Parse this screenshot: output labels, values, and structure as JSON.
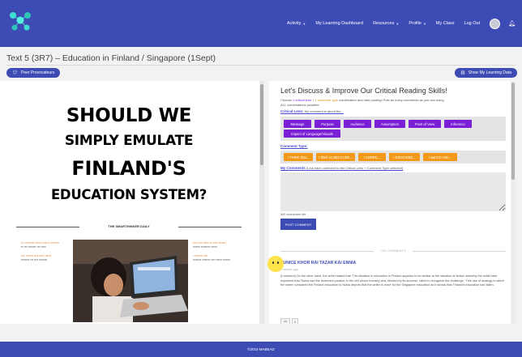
{
  "nav": {
    "items": [
      {
        "label": "Activity",
        "caret": true
      },
      {
        "label": "My Learning Dashboard",
        "caret": false
      },
      {
        "label": "Resources",
        "caret": true
      },
      {
        "label": "Profile",
        "caret": true
      },
      {
        "label": "My Class",
        "caret": false
      },
      {
        "label": "Log Out",
        "caret": false
      }
    ]
  },
  "page": {
    "title": "Text 5 (3R7) – Education in Finland / Singapore (1Sept)"
  },
  "buttons": {
    "peer": "Peer Provocateurs",
    "learning_data": "Show My Learning Data"
  },
  "article": {
    "headline_lines": [
      "SHOULD WE",
      "SIMPLY EMULATE",
      "FINLAND'S",
      "EDUCATION SYSTEM?"
    ],
    "byline": "THE SMARTHINKER DAILY"
  },
  "panel": {
    "title": "Let's Discuss & Improve Our Critical Reading Skills!",
    "instr_1": "Choose",
    "instr_lens": "1 critical lens",
    "instr_2": " + ",
    "instr_type": "1 comment type",
    "instr_3": " combination and start posting! Post as many comments as you can using",
    "instr_4": "ALL combinations possible.",
    "lens_label": "Critical Lens:",
    "lens_hint": "My comment is about the...",
    "lenses": [
      "Message",
      "Purpose",
      "Audience",
      "Assumption",
      "Point of View",
      "Inference",
      "Impact of Language/Visuals"
    ],
    "type_label": "Comment Type:",
    "types": [
      "I THINK that...",
      "I think so BECAUSE...",
      "I AGREE...",
      "I DISAGREE...",
      "I want to ASK..."
    ],
    "my_comments_label": "My Comments",
    "my_comments_hint": "(Link each comment to the Critical Lens + Comment Type selected)",
    "chars_left": "500 characters left",
    "post": "POST COMMENT",
    "comments_header": "136 COMMENTS",
    "comment": {
      "author": "EUNICE KHOR RAI TAZAR KAI ENNIA",
      "time": "2 months ago",
      "body": "[Comment] On the other hand, the writer stated that 'The situation in education in Finland appears to be similar to the situation at Nokia' whereby the writer later explained that 'Nokia had the dominant position in the cell phone industry and, blinded by its success, failed to recognize the challenge.' This use of analogy in which the writer compared the Finland education to Nokia depicts that the writer is more for the Singapore education as it shows that Finland's education had fallen.",
      "likes": "1"
    }
  },
  "footer": {
    "text": "©2015 MABEAD"
  },
  "colors": {
    "brand": "#3d4bb5",
    "purple": "#7a1fd6",
    "orange": "#f29a17"
  }
}
